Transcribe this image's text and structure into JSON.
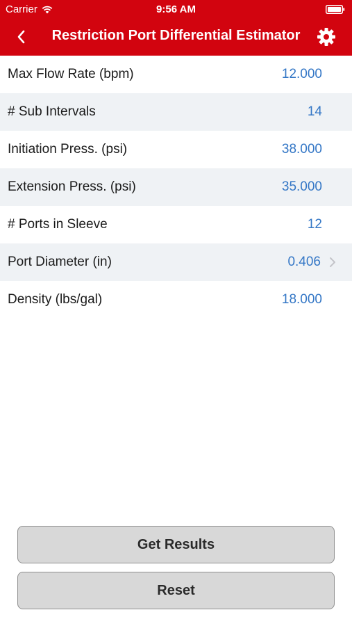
{
  "status_bar": {
    "carrier": "Carrier",
    "time": "9:56 AM"
  },
  "nav": {
    "title": "Restriction Port Differential Estimator",
    "back_icon": "chevron-left-icon",
    "settings_icon": "gear-icon"
  },
  "fields": [
    {
      "label": "Max Flow Rate (bpm)",
      "value": "12.000"
    },
    {
      "label": "# Sub Intervals",
      "value": "14"
    },
    {
      "label": "Initiation Press. (psi)",
      "value": "38.000"
    },
    {
      "label": "Extension Press. (psi)",
      "value": "35.000"
    },
    {
      "label": "# Ports in Sleeve",
      "value": "12"
    },
    {
      "label": "Port Diameter (in)",
      "value": "0.406"
    },
    {
      "label": "Density (lbs/gal)",
      "value": "18.000"
    }
  ],
  "buttons": {
    "get_results": "Get Results",
    "reset": "Reset"
  },
  "colors": {
    "header": "#d2040f",
    "value_text": "#3477c6",
    "alt_row": "#eff2f5",
    "button_bg": "#d8d8d8"
  }
}
